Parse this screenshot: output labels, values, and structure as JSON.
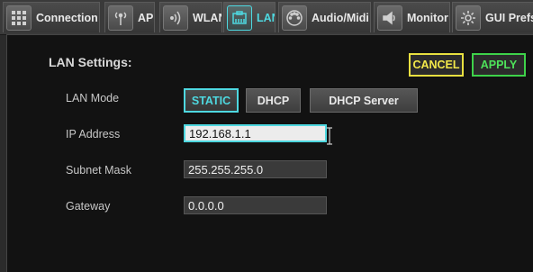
{
  "tabs": [
    {
      "label": "Connection",
      "icon": "grid-icon"
    },
    {
      "label": "AP",
      "icon": "antenna-icon"
    },
    {
      "label": "WLAN",
      "icon": "wifi-icon"
    },
    {
      "label": "LAN",
      "icon": "ethernet-icon",
      "active": true
    },
    {
      "label": "Audio/Midi",
      "icon": "midi-icon"
    },
    {
      "label": "Monitor",
      "icon": "speaker-icon"
    },
    {
      "label": "GUI Prefs",
      "icon": "gear-icon"
    }
  ],
  "lan": {
    "title": "LAN Settings:",
    "cancel_label": "CANCEL",
    "apply_label": "APPLY",
    "mode_label": "LAN Mode",
    "modes": [
      "STATIC",
      "DHCP",
      "DHCP Server"
    ],
    "selected_mode": "STATIC",
    "ip_label": "IP Address",
    "ip_value": "192.168.1.1",
    "subnet_label": "Subnet Mask",
    "subnet_value": "255.255.255.0",
    "gateway_label": "Gateway",
    "gateway_value": "0.0.0.0"
  },
  "colors": {
    "accent": "#4ed8e0",
    "cancel": "#e8e040",
    "apply": "#3ed24a"
  }
}
